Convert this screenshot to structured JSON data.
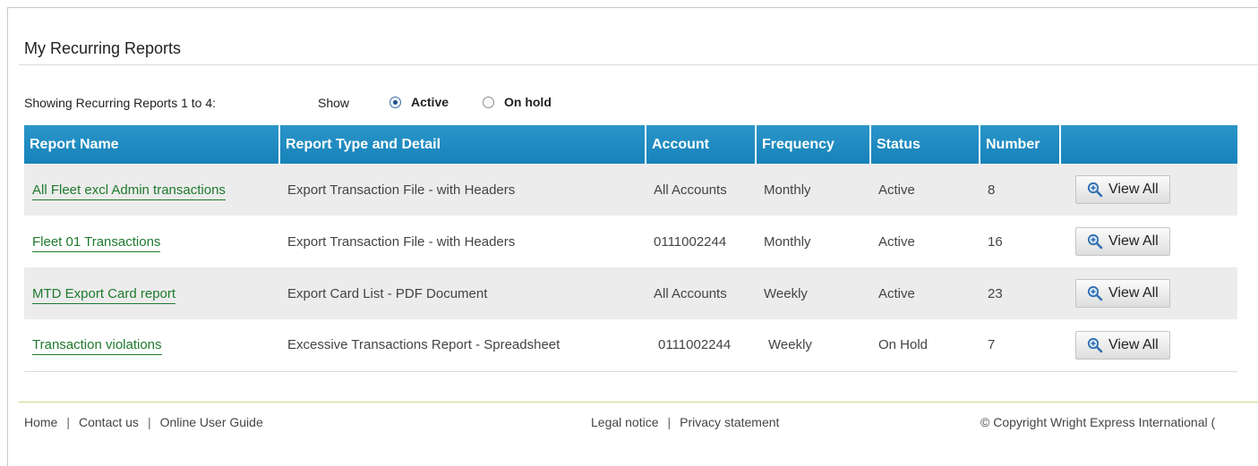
{
  "page": {
    "title": "My Recurring Reports"
  },
  "filter": {
    "showing_text": "Showing Recurring Reports 1 to 4:",
    "show_label": "Show",
    "options": [
      {
        "label": "Active",
        "checked": true
      },
      {
        "label": "On hold",
        "checked": false
      }
    ]
  },
  "table": {
    "headers": [
      "Report Name",
      "Report Type and Detail",
      "Account",
      "Frequency",
      "Status",
      "Number",
      ""
    ],
    "rows": [
      {
        "name": "All Fleet excl Admin transactions",
        "type": "Export Transaction File - with Headers",
        "account": "All Accounts",
        "frequency": "Monthly",
        "status": "Active",
        "number": "8",
        "action": "View All"
      },
      {
        "name": "Fleet 01 Transactions",
        "type": "Export Transaction File - with Headers",
        "account": "0111002244",
        "frequency": "Monthly",
        "status": "Active",
        "number": "16",
        "action": "View All"
      },
      {
        "name": "MTD Export Card report",
        "type": "Export Card List - PDF Document",
        "account": "All Accounts",
        "frequency": "Weekly",
        "status": "Active",
        "number": "23",
        "action": "View All"
      },
      {
        "name": "Transaction violations",
        "type": "Excessive Transactions Report - Spreadsheet",
        "account": "0111002244",
        "frequency": "Weekly",
        "status": "On Hold",
        "number": "7",
        "action": "View All"
      }
    ]
  },
  "footer": {
    "left_links": [
      "Home",
      "Contact us",
      "Online User Guide"
    ],
    "mid_links": [
      "Legal notice",
      "Privacy statement"
    ],
    "copyright": "© Copyright Wright Express International ("
  },
  "colors": {
    "header_blue": "#1f8cc2",
    "link_green": "#1f7a2e",
    "row_stripe": "#ececec",
    "footer_rule": "#c6d98a"
  },
  "icons": {
    "view_button": "magnifier-zoom-icon"
  }
}
